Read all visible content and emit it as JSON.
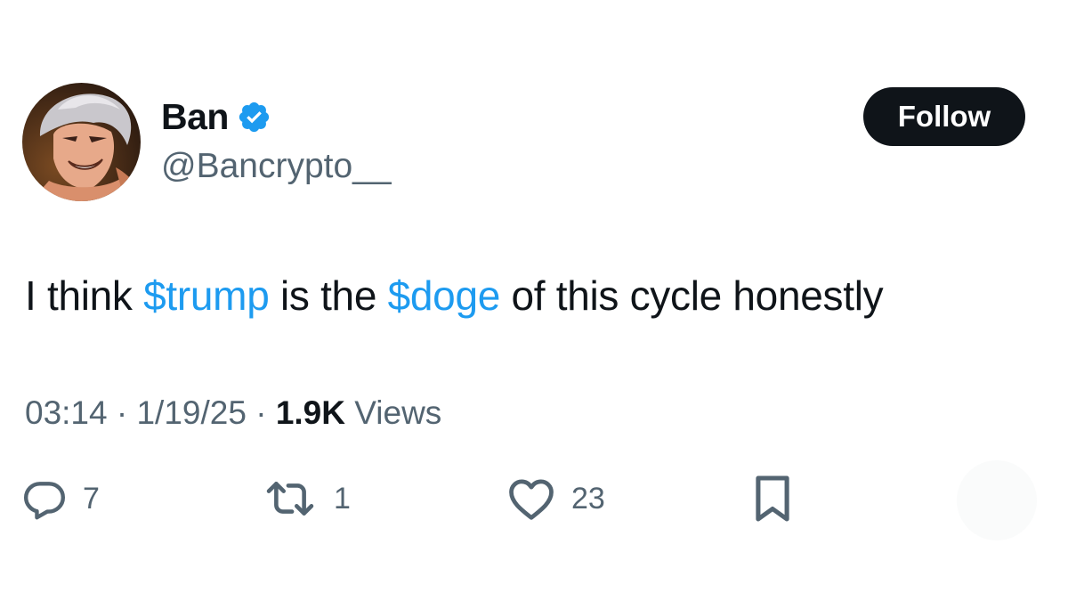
{
  "author": {
    "name": "Ban",
    "handle": "@Bancrypto__",
    "verified": true
  },
  "follow_button": {
    "label": "Follow"
  },
  "tweet": {
    "segments": [
      {
        "text": "I think ",
        "type": "text"
      },
      {
        "text": "$trump",
        "type": "cashtag"
      },
      {
        "text": " is the ",
        "type": "text"
      },
      {
        "text": "$doge",
        "type": "cashtag"
      },
      {
        "text": " of this cycle honestly",
        "type": "text"
      }
    ]
  },
  "meta": {
    "time": "03:14",
    "separator": " · ",
    "date": "1/19/25",
    "views_count": "1.9K",
    "views_label": " Views"
  },
  "actions": {
    "replies": "7",
    "retweets": "1",
    "likes": "23"
  },
  "colors": {
    "accent": "#1d9bf0",
    "text": "#0f1419",
    "secondary": "#536471",
    "button_bg": "#0f1419"
  },
  "icons": [
    "verified-badge-icon",
    "reply-icon",
    "retweet-icon",
    "like-icon",
    "bookmark-icon"
  ]
}
